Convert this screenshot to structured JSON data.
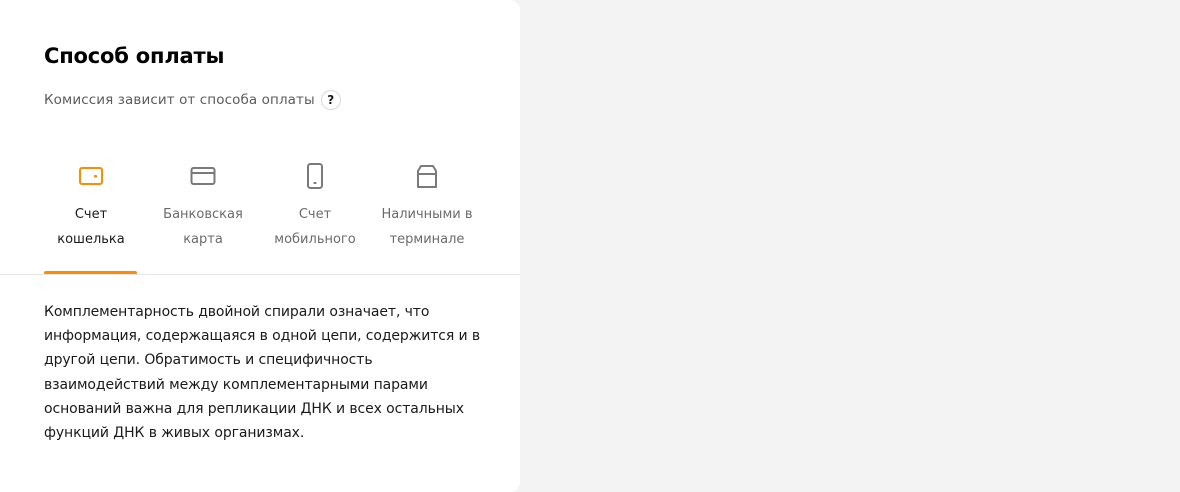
{
  "payment": {
    "title": "Способ оплаты",
    "subtitle": "Комиссия зависит от способа оплаты",
    "help_label": "?",
    "tabs": [
      {
        "line1": "Счет",
        "line2": "кошелька",
        "icon": "wallet-icon",
        "active": true
      },
      {
        "line1": "Банковская",
        "line2": "карта",
        "icon": "card-icon",
        "active": false
      },
      {
        "line1": "Счет",
        "line2": "мобильного",
        "icon": "phone-icon",
        "active": false
      },
      {
        "line1": "Наличными в",
        "line2": "терминале",
        "icon": "terminal-icon",
        "active": false
      }
    ],
    "description": "Комплементарность двойной спирали означает, что информация, содержащаяся в одной цепи, содержится и в другой цепи. Обратимость и специфичность взаимодействий между комплементарными парами оснований важна для репликации ДНК и всех остальных функций ДНК в живых организмах."
  },
  "colors": {
    "accent": "#ff8c00",
    "icon_inactive": "#7a7a7a",
    "page_bg": "#f3f3f3",
    "card_bg": "#ffffff"
  }
}
